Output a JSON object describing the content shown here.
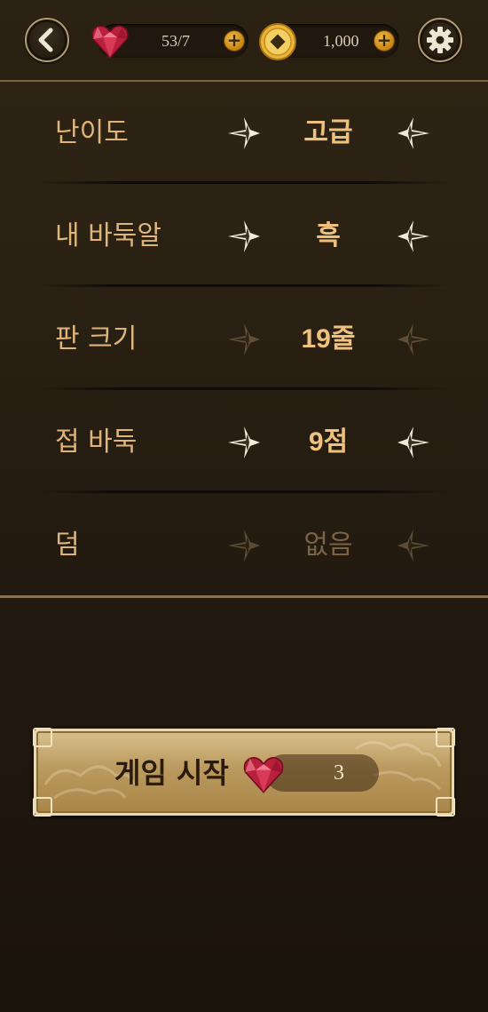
{
  "header": {
    "hearts": "53/7",
    "coins": "1,000",
    "back_icon": "back-arrow-icon",
    "settings_icon": "gear-icon",
    "heart_icon": "ruby-heart-icon",
    "coin_icon": "gold-coin-icon"
  },
  "settings": [
    {
      "label": "난이도",
      "value": "고급"
    },
    {
      "label": "내 바둑알",
      "value": "흑"
    },
    {
      "label": "판 크기",
      "value": "19줄"
    },
    {
      "label": "접 바둑",
      "value": "9점"
    },
    {
      "label": "덤",
      "value": "없음"
    }
  ],
  "start_button": {
    "label": "게임 시작",
    "cost": "3"
  },
  "colors": {
    "accent_gold": "#efc17d",
    "label_gold": "#e0b57a",
    "background": "#2a2113",
    "button_gold": "#c5a66c"
  }
}
